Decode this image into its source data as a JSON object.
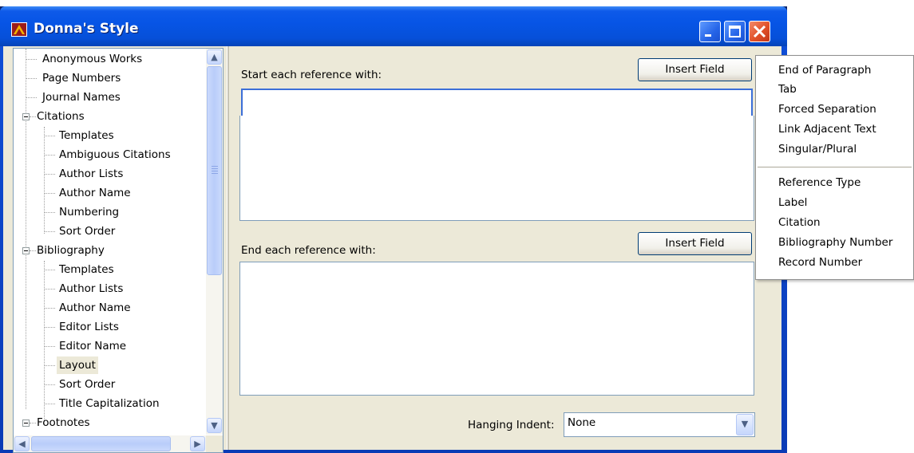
{
  "window": {
    "title": "Donna's Style"
  },
  "tree": {
    "items": [
      {
        "label": "Anonymous Works",
        "level": 1
      },
      {
        "label": "Page Numbers",
        "level": 1
      },
      {
        "label": "Journal Names",
        "level": 1
      },
      {
        "label": "Citations",
        "level": 0,
        "expanded": true
      },
      {
        "label": "Templates",
        "level": 1
      },
      {
        "label": "Ambiguous Citations",
        "level": 1
      },
      {
        "label": "Author Lists",
        "level": 1
      },
      {
        "label": "Author Name",
        "level": 1
      },
      {
        "label": "Numbering",
        "level": 1
      },
      {
        "label": "Sort Order",
        "level": 1
      },
      {
        "label": "Bibliography",
        "level": 0,
        "expanded": true
      },
      {
        "label": "Templates",
        "level": 1
      },
      {
        "label": "Author Lists",
        "level": 1
      },
      {
        "label": "Author Name",
        "level": 1
      },
      {
        "label": "Editor Lists",
        "level": 1
      },
      {
        "label": "Editor Name",
        "level": 1
      },
      {
        "label": "Layout",
        "level": 1,
        "selected": true
      },
      {
        "label": "Sort Order",
        "level": 1
      },
      {
        "label": "Title Capitalization",
        "level": 1
      },
      {
        "label": "Footnotes",
        "level": 0,
        "expanded": true
      }
    ]
  },
  "panel": {
    "start_label": "Start each reference with:",
    "end_label": "End each reference with:",
    "insert_field_label": "Insert Field",
    "start_value": "",
    "end_value": "",
    "hanging_indent_label": "Hanging Indent:",
    "hanging_indent_value": "None"
  },
  "menu": {
    "group1": [
      "End of Paragraph",
      "Tab",
      "Forced Separation",
      "Link Adjacent Text",
      "Singular/Plural"
    ],
    "group2": [
      "Reference Type",
      "Label",
      "Citation",
      "Bibliography Number",
      "Record Number"
    ]
  }
}
